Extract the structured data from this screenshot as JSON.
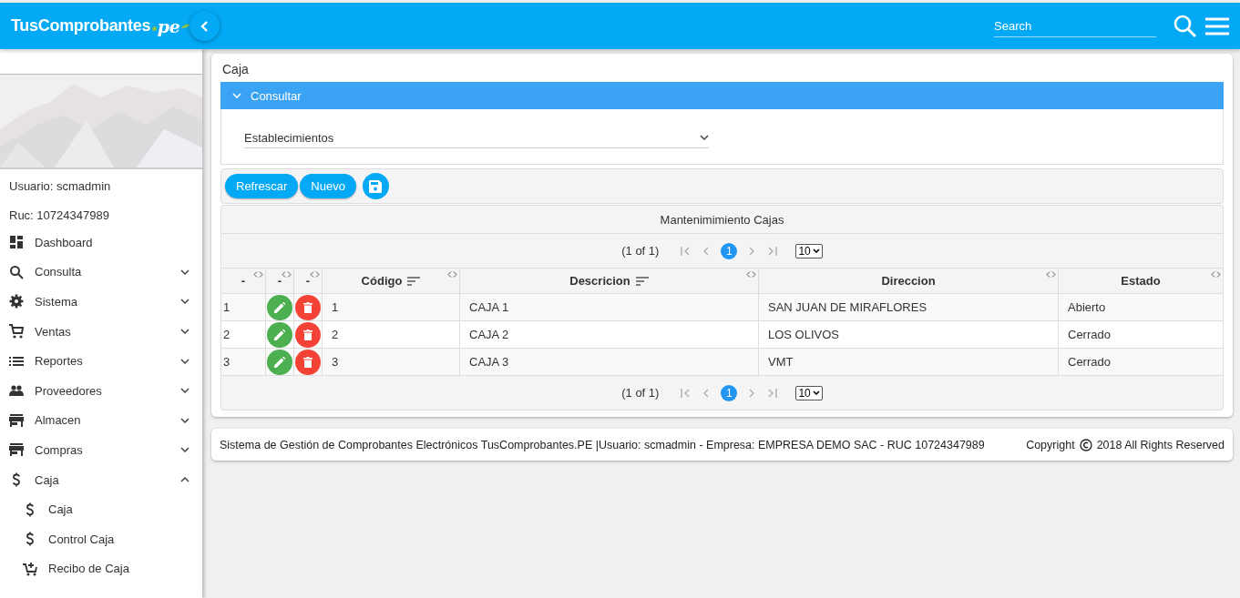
{
  "header": {
    "logo": "TusComprobantes",
    "logo_suffix": "pe",
    "search": {
      "placeholder": "Search"
    }
  },
  "sidebar": {
    "user": "Usuario: scmadmin",
    "ruc": "Ruc: 10724347989",
    "items": [
      {
        "label": "Dashboard"
      },
      {
        "label": "Consulta",
        "expanded": false
      },
      {
        "label": "Sistema",
        "expanded": false
      },
      {
        "label": "Ventas",
        "expanded": false
      },
      {
        "label": "Reportes",
        "expanded": false
      },
      {
        "label": "Proveedores",
        "expanded": false
      },
      {
        "label": "Almacen",
        "expanded": false
      },
      {
        "label": "Compras",
        "expanded": false
      },
      {
        "label": "Caja",
        "expanded": true,
        "children": [
          {
            "label": "Caja"
          },
          {
            "label": "Control Caja"
          },
          {
            "label": "Recibo de Caja"
          }
        ]
      }
    ]
  },
  "page": {
    "title": "Caja",
    "panel": {
      "title": "Consultar",
      "expanded": true
    },
    "establecimientos": {
      "label": "Establecimientos"
    },
    "buttons": [
      "Refrescar",
      "Nuevo"
    ],
    "table": {
      "caption": "Mantenimimiento Cajas",
      "paginators": [
        {
          "report": "(1 of 1)",
          "pages": [
            {
              "label": "1",
              "selected": true
            }
          ],
          "page_size": "10"
        },
        {
          "report": "(1 of 1)",
          "pages": [
            {
              "label": "1",
              "selected": true
            }
          ],
          "page_size": "10"
        }
      ],
      "columns": [
        {
          "label": "-",
          "sortable": false
        },
        {
          "label": "-",
          "sortable": false
        },
        {
          "label": "-",
          "sortable": false
        },
        {
          "label": "Código",
          "sortable": true
        },
        {
          "label": "Descricion",
          "sortable": true
        },
        {
          "label": "Direccion",
          "sortable": false
        },
        {
          "label": "Estado",
          "sortable": false
        }
      ],
      "rows": [
        {
          "index": "1",
          "codigo": "1",
          "descripcion": "CAJA 1",
          "direccion": "SAN JUAN DE MIRAFLORES",
          "estado": "Abierto"
        },
        {
          "index": "2",
          "codigo": "2",
          "descripcion": "CAJA 2",
          "direccion": "LOS OLIVOS",
          "estado": "Cerrado"
        },
        {
          "index": "3",
          "codigo": "3",
          "descripcion": "CAJA 3",
          "direccion": "VMT",
          "estado": "Cerrado"
        }
      ]
    }
  },
  "footer": {
    "text": "Sistema de Gestión de Comprobantes Electrónicos TusComprobantes.PE |Usuario: scmadmin - Empresa: EMPRESA DEMO SAC - RUC 10724347989",
    "copyright_left": "Copyright",
    "copyright_right": "2018 All Rights Reserved"
  }
}
